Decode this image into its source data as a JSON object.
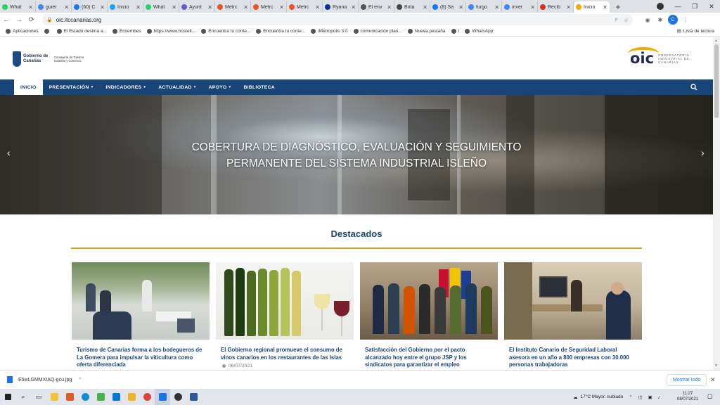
{
  "browser": {
    "tabs": [
      {
        "label": "What",
        "color": "#25d366"
      },
      {
        "label": "guier",
        "color": "#4285f4"
      },
      {
        "label": "(60) C",
        "color": "#1877f2"
      },
      {
        "label": "Inicio",
        "color": "#1da1f2"
      },
      {
        "label": "What",
        "color": "#25d366"
      },
      {
        "label": "Ayunt",
        "color": "#6a5acd"
      },
      {
        "label": "Metrc",
        "color": "#e8542c"
      },
      {
        "label": "Metrc",
        "color": "#e8542c"
      },
      {
        "label": "Metrc",
        "color": "#e8542c"
      },
      {
        "label": "Ryana",
        "color": "#073590"
      },
      {
        "label": "El env",
        "color": "#555555"
      },
      {
        "label": "Brita",
        "color": "#444444"
      },
      {
        "label": "(8) Sa",
        "color": "#1877f2"
      },
      {
        "label": "furgo",
        "color": "#4285f4"
      },
      {
        "label": "inver",
        "color": "#4285f4"
      },
      {
        "label": "Recib",
        "color": "#d93025"
      },
      {
        "label": "Inicio",
        "color": "#f2a900"
      }
    ],
    "new_tab": "+",
    "window_controls": [
      "—",
      "❐",
      "✕"
    ],
    "url": "oic.itccanarias.org",
    "avatar_letter": "C",
    "bookmarks": [
      "Aplicaciones",
      "",
      "El Estado destina a...",
      "Ecoembes",
      "https://www.hostelt...",
      "Encuentra tu conte...",
      "Encuentra tu conte...",
      "iMetropolis 3.0",
      "comunicación plan...",
      "Nueva pestaña",
      "I",
      "WhatsApp"
    ],
    "reading_list": "Lista de lectura"
  },
  "site": {
    "gobierno": "Gobierno de Canarias",
    "consejeria": "Consejería de Turismo, Industria y Comercio",
    "oic_mark": "oic",
    "oic_subtitle": "OBSERVATORIO INDUSTRIAL DE CANARIAS",
    "nav": [
      {
        "label": "INICIO",
        "caret": ""
      },
      {
        "label": "PRESENTACIÓN",
        "caret": "▾"
      },
      {
        "label": "INDICADORES",
        "caret": "▾"
      },
      {
        "label": "ACTUALIDAD",
        "caret": "▾"
      },
      {
        "label": "APOYO",
        "caret": "▾"
      },
      {
        "label": "BIBLIOTECA",
        "caret": ""
      }
    ],
    "hero": {
      "line1": "COBERTURA DE DIAGNÓSTICO, EVALUACIÓN Y SEGUIMIENTO",
      "line2": "PERMANENTE DEL SISTEMA INDUSTRIAL ISLEÑO",
      "prev": "‹",
      "next": "›"
    },
    "section_title": "Destacados",
    "cards": [
      {
        "title": "Turismo de Canarias forma a los bodegueros de La Gomera para impulsar la viticultura como oferta diferenciada",
        "date": ""
      },
      {
        "title": "El Gobierno regional promueve el consumo de vinos canarios en los restaurantes de las Islas",
        "date": "06/07/2021"
      },
      {
        "title": "Satisfacción del Gobierno por el pacto alcanzado hoy entre el grupo JSP y los sindicatos para garantizar el empleo",
        "date": ""
      },
      {
        "title": "El Instituto Canario de Seguridad Laboral asesora en un año a 800 empresas con 30.000 personas trabajadoras",
        "date": ""
      }
    ]
  },
  "download": {
    "filename": "E5wLGMMXIAQ-gcu.jpg",
    "chevron": "^",
    "show_all": "Mostrar todo",
    "close": "✕"
  },
  "taskbar": {
    "weather": "17°C  Mayor. nublado",
    "time": "11:27",
    "date": "08/07/2021"
  }
}
